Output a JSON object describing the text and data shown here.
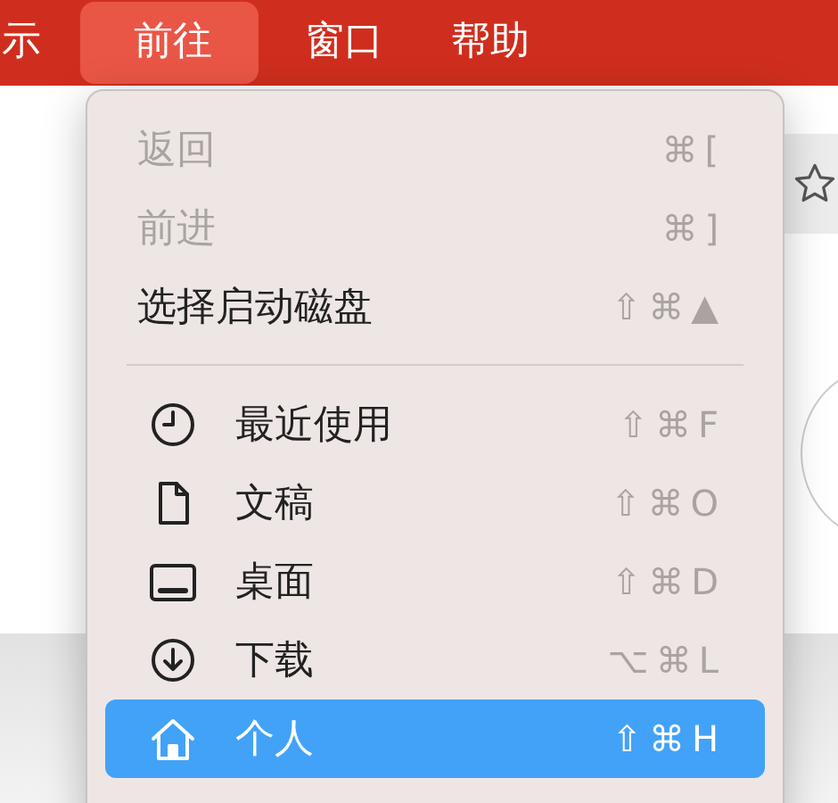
{
  "menu_bar": [
    {
      "label": "示",
      "selected": false
    },
    {
      "label": "前往",
      "selected": true
    },
    {
      "label": "窗口",
      "selected": false
    },
    {
      "label": "帮助",
      "selected": false
    }
  ],
  "menu": [
    {
      "kind": "item",
      "label": "返回",
      "shortcut": "⌘[",
      "disabled": true,
      "selected": false
    },
    {
      "kind": "item",
      "label": "前进",
      "shortcut": "⌘]",
      "disabled": true,
      "selected": false
    },
    {
      "kind": "item",
      "label": "选择启动磁盘",
      "shortcut": "⇧⌘▲",
      "disabled": false,
      "selected": false
    },
    {
      "kind": "separator"
    },
    {
      "kind": "item",
      "label": "最近使用",
      "shortcut": "⇧⌘F",
      "disabled": false,
      "selected": false
    },
    {
      "kind": "item",
      "label": "文稿",
      "shortcut": "⇧⌘O",
      "disabled": false,
      "selected": false
    },
    {
      "kind": "item",
      "label": "桌面",
      "shortcut": "⇧⌘D",
      "disabled": false,
      "selected": false
    },
    {
      "kind": "item",
      "label": "下载",
      "shortcut": "⌥⌘L",
      "disabled": false,
      "selected": false
    },
    {
      "kind": "item",
      "label": "个人",
      "shortcut": "⇧⌘H",
      "disabled": false,
      "selected": true
    }
  ]
}
